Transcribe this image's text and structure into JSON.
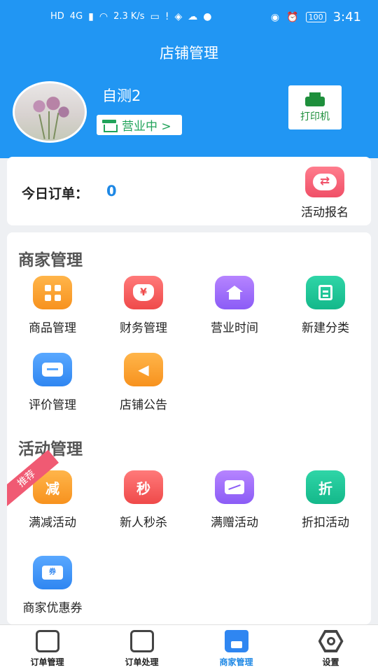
{
  "status_bar": {
    "left_tags": [
      "HD",
      "4G",
      "2.3 K/s"
    ],
    "battery": "100",
    "time": "3:41"
  },
  "header": {
    "title": "店铺管理",
    "shop_name": "自测2",
    "status_label": "营业中 >",
    "printer_label": "打印机"
  },
  "orders": {
    "today_label": "今日订单：",
    "today_value": "0",
    "promo_label": "活动报名"
  },
  "merchant": {
    "title": "商家管理",
    "items": [
      {
        "label": "商品管理",
        "icon": "grid-icon"
      },
      {
        "label": "财务管理",
        "icon": "money-bag-icon",
        "glyph": "¥"
      },
      {
        "label": "营业时间",
        "icon": "house-icon"
      },
      {
        "label": "新建分类",
        "icon": "clipboard-icon"
      },
      {
        "label": "评价管理",
        "icon": "chat-icon"
      },
      {
        "label": "店铺公告",
        "icon": "speaker-icon"
      }
    ]
  },
  "activity": {
    "title": "活动管理",
    "badge": "推荐",
    "items": [
      {
        "label": "满减活动",
        "glyph": "减"
      },
      {
        "label": "新人秒杀",
        "glyph": "秒"
      },
      {
        "label": "满赠活动",
        "icon": "gift-icon"
      },
      {
        "label": "折扣活动",
        "glyph": "折"
      },
      {
        "label": "商家优惠券",
        "glyph": "券"
      }
    ]
  },
  "tabbar": {
    "items": [
      {
        "label": "订单管理"
      },
      {
        "label": "订单处理"
      },
      {
        "label": "商家管理",
        "active": true
      },
      {
        "label": "设置"
      }
    ]
  },
  "colors": {
    "header_blue": "#2196f3",
    "value_blue": "#1e88e5",
    "open_green": "#21a35a"
  }
}
